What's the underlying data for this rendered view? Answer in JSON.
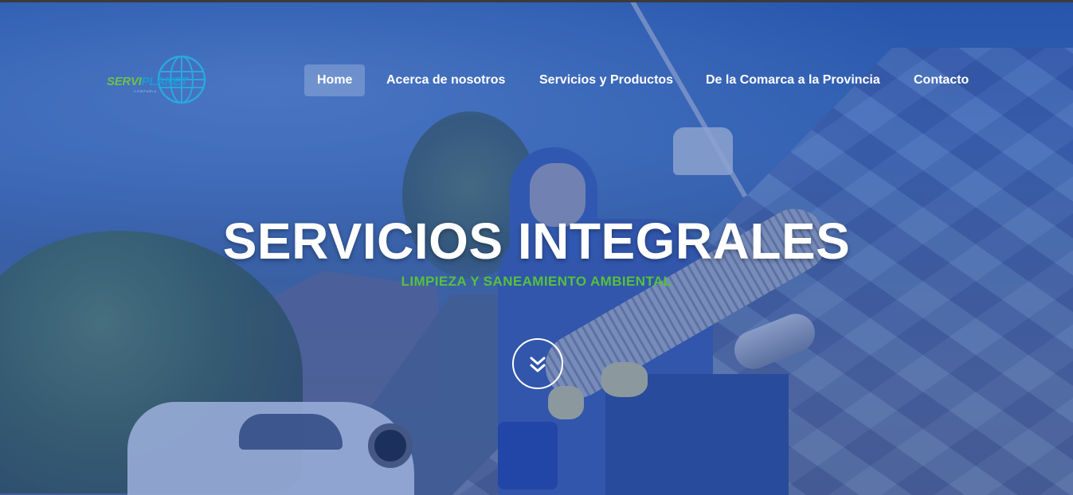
{
  "brand": {
    "logo_prefix": "SERVI",
    "logo_suffix": "PLANET",
    "logo_tagline": "COMPAÑIA"
  },
  "nav": {
    "items": [
      {
        "label": "Home",
        "active": true
      },
      {
        "label": "Acerca de nosotros",
        "active": false
      },
      {
        "label": "Servicios y Productos",
        "active": false
      },
      {
        "label": "De la Comarca a la Provincia",
        "active": false
      },
      {
        "label": "Contacto",
        "active": false
      }
    ]
  },
  "hero": {
    "title": "SERVICIOS INTEGRALES",
    "subtitle": "LIMPIEZA Y SANEAMIENTO AMBIENTAL",
    "scroll_icon": "double-chevron-down-icon"
  },
  "colors": {
    "accent_green": "#55c23c",
    "logo_blue": "#1d9ad8",
    "overlay_blue": "#1e46aa"
  }
}
